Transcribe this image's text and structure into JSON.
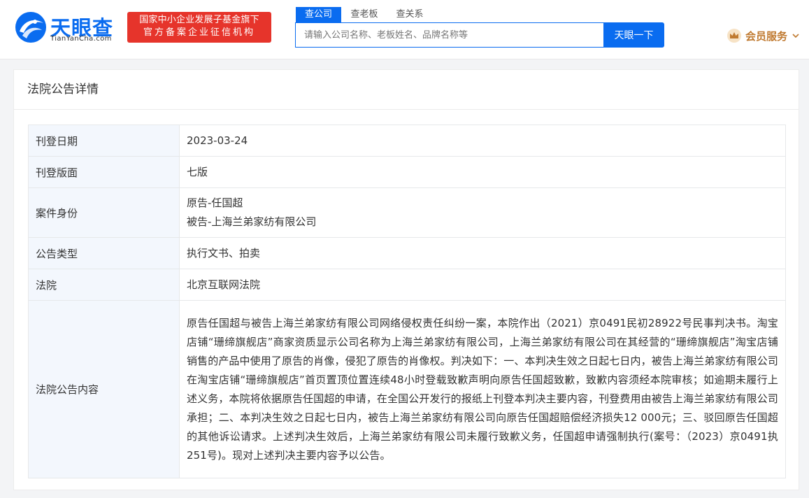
{
  "header": {
    "logo_cn": "天眼查",
    "logo_en": "TianYanCha.com",
    "banner_line1": "国家中小企业发展子基金旗下",
    "banner_line2": "官方备案企业征信机构",
    "search_tabs": [
      "查公司",
      "查老板",
      "查关系"
    ],
    "search_placeholder": "请输入公司名称、老板姓名、品牌名称等",
    "search_button": "天眼一下",
    "vip_label": "会员服务",
    "colors": {
      "brand": "#0a6cf0",
      "banner": "#e6342b",
      "vip": "#c07a30"
    },
    "icons": {
      "logo": "tianyancha-logo-icon",
      "vip": "crown-icon",
      "vip_arrow": "chevron-down-icon"
    }
  },
  "card": {
    "title": "法院公告详情",
    "rows": [
      {
        "label": "刊登日期",
        "value": "2023-03-24"
      },
      {
        "label": "刊登版面",
        "value": "七版"
      },
      {
        "label": "案件身份",
        "lines": [
          "原告-任国超",
          "被告-上海兰弟家纺有限公司"
        ]
      },
      {
        "label": "公告类型",
        "value": "执行文书、拍卖"
      },
      {
        "label": "法院",
        "value": "北京互联网法院"
      },
      {
        "label": "法院公告内容",
        "value": "原告任国超与被告上海兰弟家纺有限公司网络侵权责任纠纷一案，本院作出（2021）京0491民初28922号民事判决书。淘宝店铺“珊缔旗舰店”商家资质显示公司名称为上海兰弟家纺有限公司，上海兰弟家纺有限公司在其经营的“珊缔旗舰店”淘宝店铺销售的产品中使用了原告的肖像，侵犯了原告的肖像权。判决如下：一、本判决生效之日起七日内，被告上海兰弟家纺有限公司在淘宝店铺“珊缔旗舰店”首页置顶位置连续48小时登载致歉声明向原告任国超致歉，致歉内容须经本院审核；如逾期未履行上述义务，本院将依据原告任国超的申请，在全国公开发行的报纸上刊登本判决主要内容，刊登费用由被告上海兰弟家纺有限公司承担；二、本判决生效之日起七日内，被告上海兰弟家纺有限公司向原告任国超赔偿经济损失12 000元；三、驳回原告任国超的其他诉讼请求。上述判决生效后，上海兰弟家纺有限公司未履行致歉义务，任国超申请强制执行(案号：（2023）京0491执251号)。现对上述判决主要内容予以公告。"
      }
    ]
  }
}
